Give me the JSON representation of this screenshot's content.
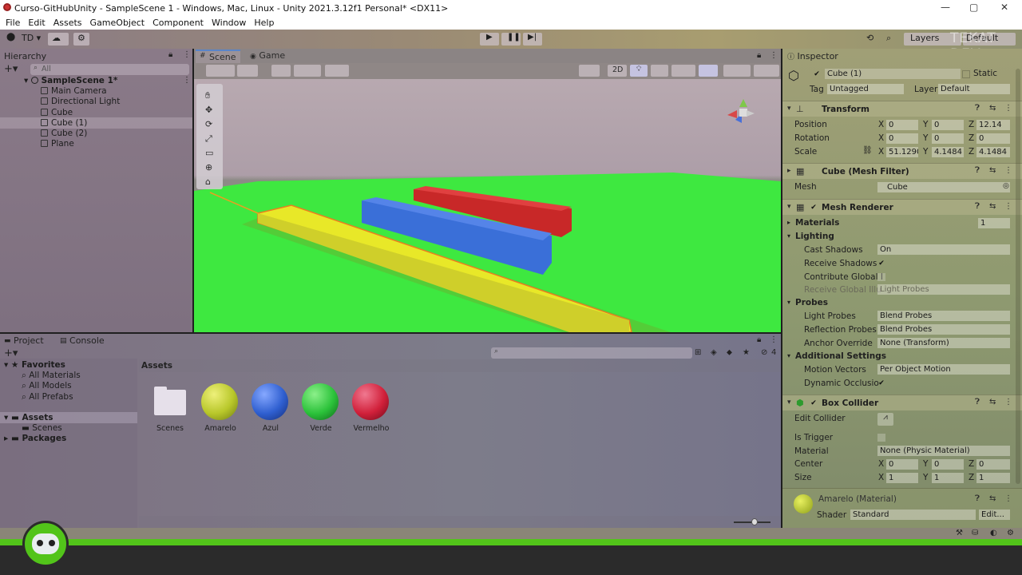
{
  "titlebar": {
    "title": "Curso-GitHubUnity - SampleScene 1 - Windows, Mac, Linux - Unity 2021.3.12f1 Personal* <DX11>",
    "min": "—",
    "max": "▢",
    "close": "✕"
  },
  "menu": [
    "File",
    "Edit",
    "Assets",
    "GameObject",
    "Component",
    "Window",
    "Help"
  ],
  "toolbar": {
    "account": "TD ▾",
    "layers": "Layers",
    "layout": "Default",
    "watermark": "TEKAT DEV"
  },
  "hierarchy": {
    "tab": "Hierarchy",
    "search_placeholder": "All",
    "scene": "SampleScene 1*",
    "items": [
      "Main Camera",
      "Directional Light",
      "Cube",
      "Cube (1)",
      "Cube (2)",
      "Plane"
    ]
  },
  "scene": {
    "tab_scene": "Scene",
    "tab_game": "Game",
    "btn_2d": "2D"
  },
  "project": {
    "tab_project": "Project",
    "tab_console": "Console",
    "hidden_count": "4",
    "breadcrumb": "Assets",
    "tree": {
      "favorites": "Favorites",
      "fav_items": [
        "All Materials",
        "All Models",
        "All Prefabs"
      ],
      "assets": "Assets",
      "scenes": "Scenes",
      "packages": "Packages"
    },
    "assets": [
      {
        "name": "Scenes",
        "type": "folder"
      },
      {
        "name": "Amarelo",
        "color": "#b8c72a"
      },
      {
        "name": "Azul",
        "color": "#2f5fd0"
      },
      {
        "name": "Verde",
        "color": "#2bc23a"
      },
      {
        "name": "Vermelho",
        "color": "#d1203a"
      }
    ]
  },
  "inspector": {
    "tab": "Inspector",
    "object_name": "Cube (1)",
    "static": "Static",
    "tag_label": "Tag",
    "tag": "Untagged",
    "layer_label": "Layer",
    "layer": "Default",
    "transform": {
      "title": "Transform",
      "position": "Position",
      "rotation": "Rotation",
      "scale": "Scale",
      "pos": {
        "x": "0",
        "y": "0",
        "z": "12.14"
      },
      "rot": {
        "x": "0",
        "y": "0",
        "z": "0"
      },
      "scl": {
        "x": "51.1290",
        "y": "4.1484",
        "z": "4.1484"
      }
    },
    "meshfilter": {
      "title": "Cube (Mesh Filter)",
      "mesh_label": "Mesh",
      "mesh": "Cube"
    },
    "meshrenderer": {
      "title": "Mesh Renderer",
      "materials": "Materials",
      "materials_count": "1",
      "lighting": "Lighting",
      "cast_shadows": "Cast Shadows",
      "cast_shadows_val": "On",
      "receive_shadows": "Receive Shadows",
      "contribute_gi": "Contribute Global I",
      "receive_gi": "Receive Global Illu",
      "receive_gi_val": "Light Probes",
      "probes": "Probes",
      "light_probes": "Light Probes",
      "light_probes_val": "Blend Probes",
      "reflection_probes": "Reflection Probes",
      "reflection_probes_val": "Blend Probes",
      "anchor_override": "Anchor Override",
      "anchor_override_val": "None (Transform)",
      "additional": "Additional Settings",
      "motion_vectors": "Motion Vectors",
      "motion_vectors_val": "Per Object Motion",
      "dynamic_occlusion": "Dynamic Occlusio"
    },
    "boxcollider": {
      "title": "Box Collider",
      "edit_collider": "Edit Collider",
      "is_trigger": "Is Trigger",
      "material": "Material",
      "material_val": "None (Physic Material)",
      "center": "Center",
      "size": "Size",
      "center_v": {
        "x": "0",
        "y": "0",
        "z": "0"
      },
      "size_v": {
        "x": "1",
        "y": "1",
        "z": "1"
      }
    },
    "material": {
      "name": "Amarelo (Material)",
      "shader_label": "Shader",
      "shader": "Standard",
      "edit": "Edit..."
    }
  },
  "colors": {
    "accent_green": "#52c41a",
    "bottom_bg": "#2b2b2b"
  }
}
